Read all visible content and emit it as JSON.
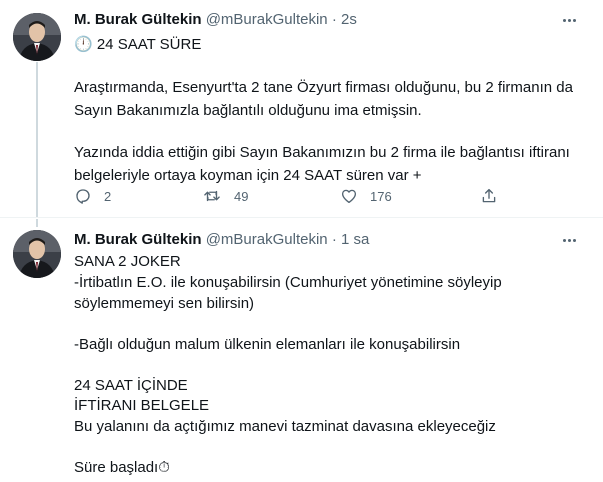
{
  "tweets": [
    {
      "author": {
        "name": "M. Burak Gültekin",
        "handle": "@mBurakGultekin"
      },
      "separator": "·",
      "time": "2s",
      "lines": [
        "🕛 24 SAAT SÜRE",
        "",
        "Araştırmanda, Esenyurt'ta 2 tane Özyurt firması olduğunu, bu 2 firmanın da",
        "Sayın Bakanımızla bağlantılı olduğunu ima etmişsin.",
        "",
        "Yazında iddia ettiğin gibi Sayın Bakanımızın bu 2 firma ile bağlantısı iftiranı",
        "belgeleriyle ortaya koyman için 24 SAAT süren var +"
      ],
      "actions": {
        "replies": "2",
        "retweets": "49",
        "likes": "176"
      },
      "icons": {
        "avatar": "profile-photo",
        "more": "more-dots-icon",
        "reply": "reply-bubble-icon",
        "retweet": "retweet-icon",
        "like": "heart-icon",
        "share": "share-upload-icon"
      }
    },
    {
      "author": {
        "name": "M. Burak Gültekin",
        "handle": "@mBurakGultekin"
      },
      "separator": "·",
      "time": "1 sa",
      "lines": [
        "SANA 2 JOKER",
        "-İrtibatlın E.O. ile konuşabilirsin (Cumhuriyet yönetimine söyleyip",
        "söylemmemeyi sen bilirsin)",
        "",
        "-Bağlı olduğun malum ülkenin elemanları ile konuşabilirsin",
        "",
        "24 SAAT İÇİNDE",
        "İFTİRANI BELGELE",
        "Bu yalanını da açtığımız manevi tazminat davasına ekleyeceğiz",
        "",
        "Süre başladı⏱"
      ],
      "icons": {
        "avatar": "profile-photo",
        "more": "more-dots-icon"
      }
    }
  ],
  "colors": {
    "text": "#0f1419",
    "secondary": "#536471",
    "thread_line": "#cfd9de",
    "divider": "#eff3f4"
  }
}
